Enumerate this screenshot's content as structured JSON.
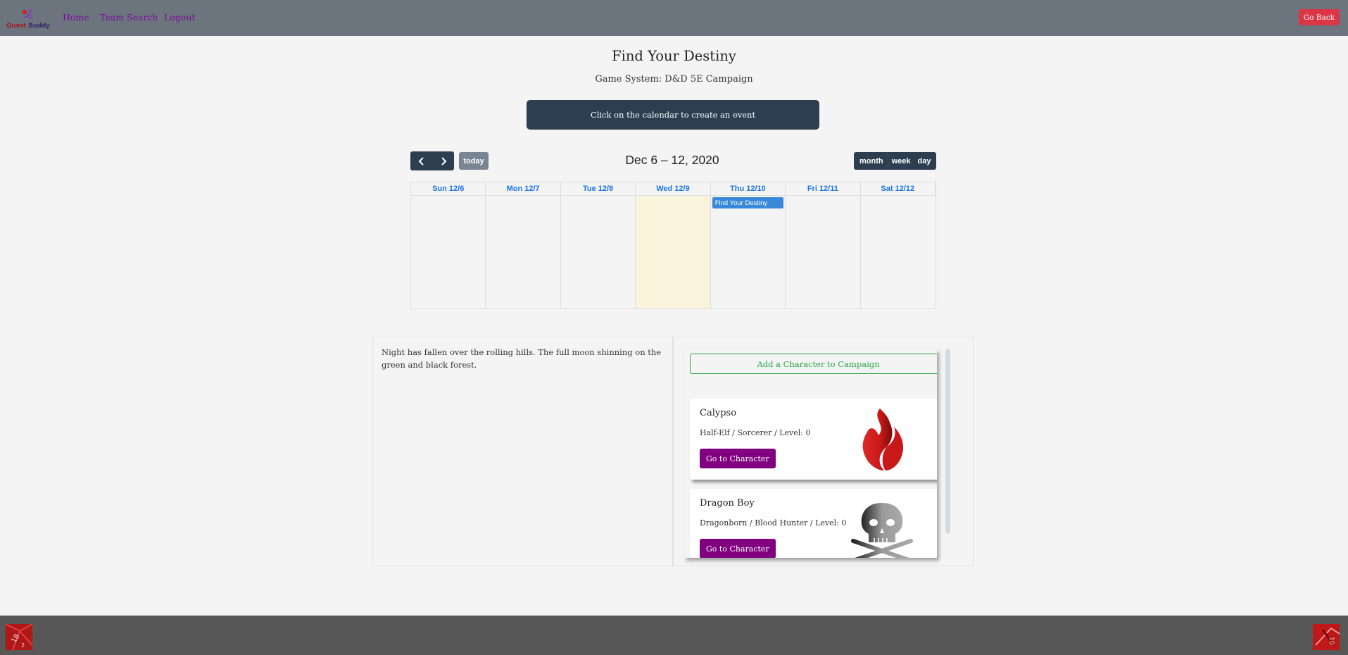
{
  "navbar": {
    "logo_text_1": "Quest",
    "logo_text_2": " Buddy",
    "links": [
      {
        "label": "Home"
      },
      {
        "label": "Team Search"
      },
      {
        "label": "Logout"
      }
    ],
    "go_back_label": "Go Back"
  },
  "header": {
    "title": "Find Your Destiny",
    "game_system": "Game System: D&D 5E Campaign",
    "instruction": "Click on the calendar to create an event"
  },
  "calendar": {
    "title": "Dec 6 – 12, 2020",
    "prev_icon": "chevron-left-icon",
    "next_icon": "chevron-right-icon",
    "today_label": "today",
    "views": [
      "month",
      "week",
      "day"
    ],
    "active_view": "week",
    "days": [
      {
        "label": "Sun 12/6",
        "today": false,
        "events": []
      },
      {
        "label": "Mon 12/7",
        "today": false,
        "events": []
      },
      {
        "label": "Tue 12/8",
        "today": false,
        "events": []
      },
      {
        "label": "Wed 12/9",
        "today": true,
        "events": []
      },
      {
        "label": "Thu 12/10",
        "today": false,
        "events": [
          "Find Your Destiny"
        ]
      },
      {
        "label": "Fri 12/11",
        "today": false,
        "events": []
      },
      {
        "label": "Sat 12/12",
        "today": false,
        "events": []
      }
    ]
  },
  "description": "Night has fallen over the rolling hills. The full moon shinning on the green and black forest.",
  "characters": {
    "add_label": "Add a Character to Campaign",
    "list": [
      {
        "name": "Calypso",
        "info": "Half-Elf / Sorcerer / Level: 0",
        "button": "Go to Character",
        "icon": "flame-icon"
      },
      {
        "name": "Dragon Boy",
        "info": "Dragonborn / Blood Hunter / Level: 0",
        "button": "Go to Character",
        "icon": "skull-crossbones-icon"
      }
    ]
  },
  "colors": {
    "navbar": "#6c757d",
    "nav_link": "#7a0c9c",
    "danger": "#dc3545",
    "dark": "#2c3e50",
    "calendar_header": "#1a73e8",
    "event": "#3788d8",
    "today_bg": "#fbf4dc",
    "success": "#28a745",
    "purple": "#800080",
    "footer": "#575757"
  }
}
